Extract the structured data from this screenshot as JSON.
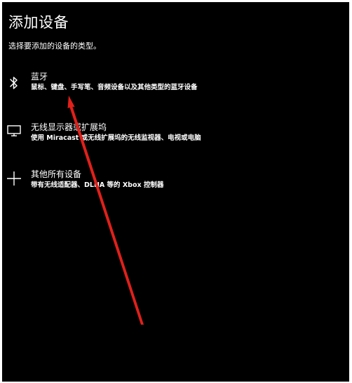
{
  "dialog": {
    "title": "添加设备",
    "subtitle": "选择要添加的设备的类型。"
  },
  "options": [
    {
      "id": "bluetooth",
      "icon": "bluetooth-icon",
      "label": "蓝牙",
      "description": "鼠标、键盘、手写笔、音频设备以及其他类型的蓝牙设备"
    },
    {
      "id": "wireless-display",
      "icon": "monitor-icon",
      "label": "无线显示器或扩展坞",
      "description": "使用 Miracast 或无线扩展坞的无线监视器、电视或电脑"
    },
    {
      "id": "everything-else",
      "icon": "plus-icon",
      "label": "其他所有设备",
      "description": "带有无线适配器、DLNA 等的 Xbox 控制器"
    }
  ],
  "colors": {
    "background": "#000000",
    "text": "#ffffff",
    "annotation_arrow": "#e0201a"
  }
}
